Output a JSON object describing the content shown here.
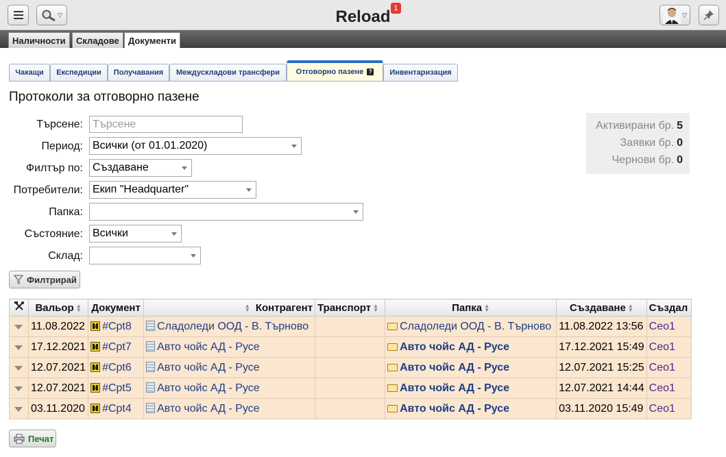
{
  "app": {
    "title": "Reload",
    "notification_count": "1"
  },
  "icons": {
    "menu": "menu-icon",
    "search": "search-icon",
    "avatar": "user-avatar-icon",
    "pin": "pin-icon",
    "tools": "tools-icon",
    "document": "document-icon",
    "contractor": "building-icon",
    "folder": "folder-icon",
    "filter": "funnel-icon",
    "print": "printer-icon",
    "help": "help-icon"
  },
  "nav": {
    "items": [
      "Наличности",
      "Складове",
      "Документи"
    ],
    "active": "Документи"
  },
  "tabs": [
    {
      "label": "Чакащи"
    },
    {
      "label": "Експедиции"
    },
    {
      "label": "Получавания"
    },
    {
      "label": "Междускладови трансфери"
    },
    {
      "label": "Отговорно пазене",
      "active": true
    },
    {
      "label": "Инвентаризация"
    }
  ],
  "page": {
    "title": "Протоколи за отговорно пазене"
  },
  "filters": {
    "search": {
      "label": "Търсене:",
      "value": "",
      "placeholder": "Търсене"
    },
    "period": {
      "label": "Период:",
      "value": "Всички (от 01.01.2020)"
    },
    "filter_by": {
      "label": "Филтър по:",
      "value": "Създаване"
    },
    "users": {
      "label": "Потребители:",
      "value": "Екип \"Headquarter\""
    },
    "folder": {
      "label": "Папка:",
      "value": ""
    },
    "state": {
      "label": "Състояние:",
      "value": "Всички"
    },
    "warehouse": {
      "label": "Склад:",
      "value": ""
    },
    "button_label": "Филтрирай"
  },
  "stats": {
    "active": {
      "label": "Активирани бр.",
      "value": "5"
    },
    "requests": {
      "label": "Заявки бр.",
      "value": "0"
    },
    "drafts": {
      "label": "Чернови бр.",
      "value": "0"
    }
  },
  "table": {
    "columns": {
      "valor": "Вальор",
      "document": "Документ",
      "contragent": "Контрагент",
      "transport": "Транспорт",
      "folder": "Папка",
      "created": "Създаване",
      "created_by": "Създал"
    },
    "rows": [
      {
        "valor": "11.08.2022",
        "document": "#Cpt8",
        "contragent": "Сладоледи ООД - В. Търново",
        "transport": "",
        "folder": "Сладоледи ООД - В. Търново",
        "folder_bold": false,
        "created": "11.08.2022 13:56",
        "created_by": "Ceo1"
      },
      {
        "valor": "17.12.2021",
        "document": "#Cpt7",
        "contragent": "Авто чойс АД - Русе",
        "transport": "",
        "folder": "Авто чойс АД - Русе",
        "folder_bold": true,
        "created": "17.12.2021 15:49",
        "created_by": "Ceo1"
      },
      {
        "valor": "12.07.2021",
        "document": "#Cpt6",
        "contragent": "Авто чойс АД - Русе",
        "transport": "",
        "folder": "Авто чойс АД - Русе",
        "folder_bold": true,
        "created": "12.07.2021 15:25",
        "created_by": "Ceo1"
      },
      {
        "valor": "12.07.2021",
        "document": "#Cpt5",
        "contragent": "Авто чойс АД - Русе",
        "transport": "",
        "folder": "Авто чойс АД - Русе",
        "folder_bold": true,
        "created": "12.07.2021 14:44",
        "created_by": "Ceo1"
      },
      {
        "valor": "03.11.2020",
        "document": "#Cpt4",
        "contragent": "Авто чойс АД - Русе",
        "transport": "",
        "folder": "Авто чойс АД - Русе",
        "folder_bold": true,
        "created": "03.11.2020 15:49",
        "created_by": "Ceo1"
      }
    ]
  },
  "print_label": "Печат"
}
